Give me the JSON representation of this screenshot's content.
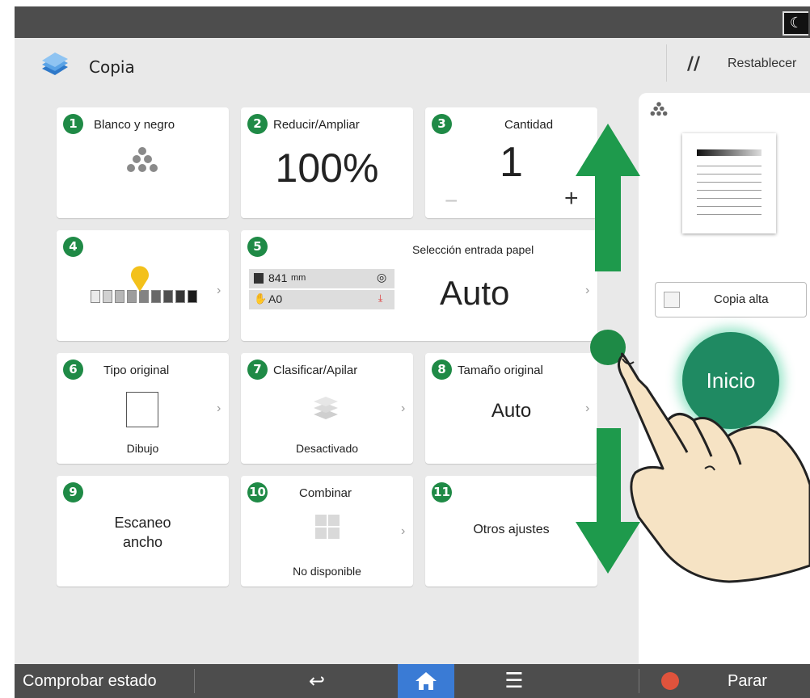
{
  "app": {
    "title": "Copia",
    "icon": "copy-book-icon"
  },
  "header": {
    "reset_label": "Restablecer",
    "reset_icon": "reset-slash-icon",
    "night_icon": "moon-icon"
  },
  "tiles": {
    "color_mode": {
      "num": "1",
      "label": "Blanco y negro",
      "icon": "toner-dots-icon"
    },
    "reduce_enlarge": {
      "num": "2",
      "label": "Reducir/Ampliar",
      "value": "100%"
    },
    "quantity": {
      "num": "3",
      "label": "Cantidad",
      "value": "1",
      "minus": "−",
      "plus": "+"
    },
    "density": {
      "num": "4",
      "level_percent": 55,
      "icon": "density-marker-icon"
    },
    "paper_select": {
      "num": "5",
      "label": "Selección entrada papel",
      "value": "Auto",
      "roll_width": "841",
      "roll_unit": "mm",
      "paper_size": "A0",
      "icons": [
        "roll-icon",
        "hand-tray-icon",
        "roll-feed-icon",
        "paper-down-icon"
      ]
    },
    "original_type": {
      "num": "6",
      "label": "Tipo original",
      "value": "Dibujo",
      "icon": "page-icon"
    },
    "sort_stack": {
      "num": "7",
      "label": "Clasificar/Apilar",
      "value": "Desactivado",
      "icon": "stack-icon"
    },
    "original_size": {
      "num": "8",
      "label": "Tamaño original",
      "value": "Auto"
    },
    "wide_scan": {
      "num": "9",
      "label_line1": "Escaneo",
      "label_line2": "ancho"
    },
    "combine": {
      "num": "10",
      "label": "Combinar",
      "value": "No disponible",
      "icon": "combine-grid-icon"
    },
    "other": {
      "num": "11",
      "label": "Otros ajustes"
    }
  },
  "right_panel": {
    "toner_icon": "toner-dots-icon",
    "copy_tall_label": "Copia alta",
    "start_label": "Inicio"
  },
  "bottom": {
    "status_label": "Comprobar estado",
    "back_icon": "back-arrow-icon",
    "home_icon": "home-icon",
    "menu_icon": "menu-icon",
    "stop_label": "Parar",
    "stop_icon": "stop-icon"
  },
  "overlay": {
    "arrows": [
      "scroll-up-arrow",
      "scroll-down-arrow"
    ],
    "touch_point_icon": "touch-point-icon",
    "hand_icon": "swipe-hand-icon"
  },
  "colors": {
    "accent_green": "#1f8a46",
    "start_green": "#1f8a62",
    "home_blue": "#3a7bd5",
    "marker_yellow": "#f3c11b",
    "bar_gray": "#4d4d4d"
  }
}
